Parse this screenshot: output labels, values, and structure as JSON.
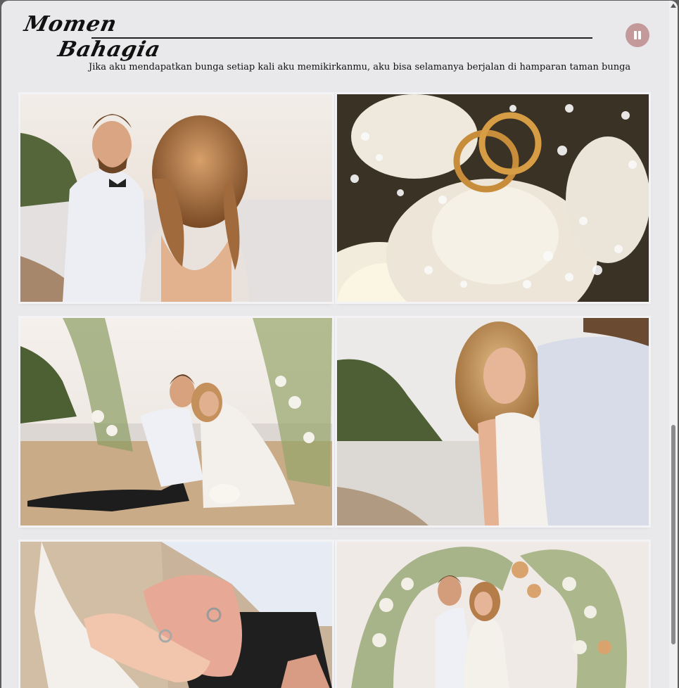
{
  "header": {
    "title_line1": "Momen",
    "title_line2": "Bahagia",
    "subtitle": "Jika aku mendapatkan bunga setiap kali aku memikirkanmu, aku bisa selamanya berjalan di hamparan taman bunga"
  },
  "music": {
    "icon": "pause-icon",
    "color": "#c4999a"
  },
  "gallery": {
    "photos": [
      {
        "name": "photo-couple-beach-back"
      },
      {
        "name": "photo-wedding-rings-roses"
      },
      {
        "name": "photo-couple-sitting-flower-arch"
      },
      {
        "name": "photo-bride-looking-back"
      },
      {
        "name": "photo-rings-in-hands"
      },
      {
        "name": "photo-couple-under-flower-arch"
      }
    ]
  },
  "colors": {
    "background": "#e9e9ec",
    "accent": "#c4999a"
  }
}
